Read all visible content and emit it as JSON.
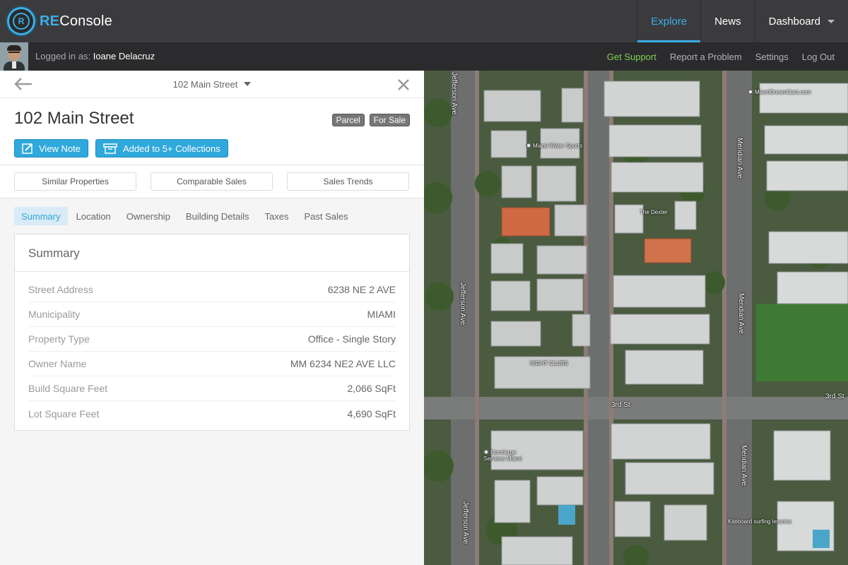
{
  "app": {
    "logo_prefix": "RE",
    "logo_suffix": "Console",
    "logo_mark": "R",
    "nav": [
      {
        "label": "Explore",
        "active": true
      },
      {
        "label": "News",
        "active": false
      },
      {
        "label": "Dashboard",
        "active": false
      }
    ]
  },
  "subbar": {
    "logged_in_prefix": "Logged in as:",
    "user_name": "Ioane Delacruz",
    "links": [
      "Get Support",
      "Report a Problem",
      "Settings",
      "Log Out"
    ]
  },
  "property": {
    "breadcrumb": "102 Main Street",
    "title": "102 Main Street",
    "tags": [
      "Parcel",
      "For Sale"
    ],
    "actions": {
      "view_note": "View Note",
      "collections": "Added to 5+ Collections"
    },
    "tools": [
      "Similar Properties",
      "Comparable Sales",
      "Sales Trends"
    ],
    "tabs": [
      {
        "label": "Summary",
        "active": true
      },
      {
        "label": "Location",
        "active": false
      },
      {
        "label": "Ownership",
        "active": false
      },
      {
        "label": "Building Details",
        "active": false
      },
      {
        "label": "Taxes",
        "active": false
      },
      {
        "label": "Past Sales",
        "active": false
      }
    ],
    "summary": {
      "title": "Summary",
      "rows": [
        {
          "label": "Street Address",
          "value": "6238 NE 2 AVE"
        },
        {
          "label": "Municipality",
          "value": "MIAMI"
        },
        {
          "label": "Property Type",
          "value": "Office - Single Story"
        },
        {
          "label": "Owner Name",
          "value": "MM 6234 NE2 AVE LLC"
        },
        {
          "label": "Build Square Feet",
          "value": "2,066 SqFt"
        },
        {
          "label": "Lot Square Feet",
          "value": "4,690 SqFt"
        }
      ]
    }
  },
  "map": {
    "streets": {
      "jefferson_top": "Jefferson Ave",
      "jefferson_bottom": "Jefferson Ave",
      "jefferson_left": "Jefferson Ave",
      "meridian_top": "Meridian Ave",
      "meridian_mid": "Meridian Ave",
      "meridian_bottom": "Meridian Ave",
      "third_st_left": "3rd St",
      "third_st_right": "3rd St"
    },
    "places": {
      "miami_water_sports": "Miami Water Sports",
      "the_dexter": "The Dexter",
      "miami_dream_cars": "MiamiDreamCars.com",
      "night_clubs": "NIGHT CLUBS",
      "concierge": "Concierge Services Miami",
      "kiteboard": "Kiteboard surfing lessons"
    }
  }
}
